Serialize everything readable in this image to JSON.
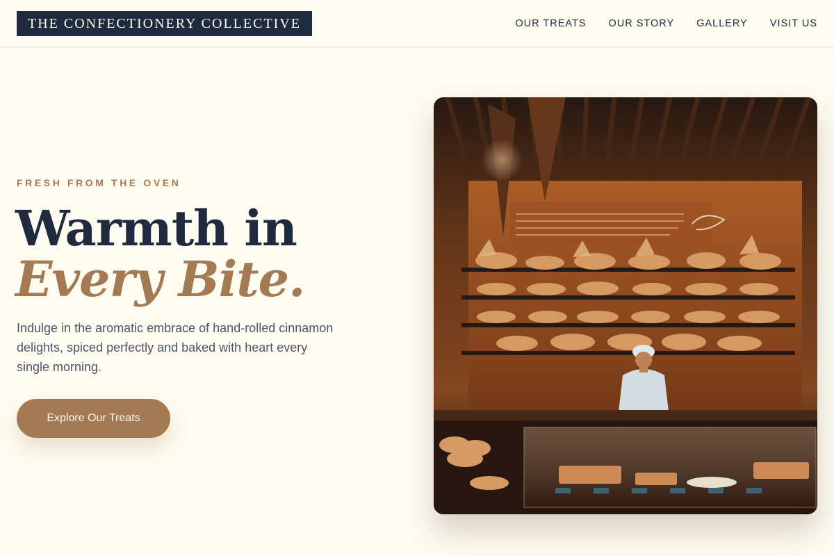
{
  "header": {
    "logo": "THE CONFECTIONERY COLLECTIVE",
    "nav": [
      "OUR TREATS",
      "OUR STORY",
      "GALLERY",
      "VISIT US"
    ]
  },
  "hero": {
    "eyebrow": "FRESH FROM THE OVEN",
    "title_line1": "Warmth in",
    "title_line2": "Every Bite.",
    "description": "Indulge in the aromatic embrace of hand-rolled cinnamon delights, spiced perfectly and baked with heart every single morning.",
    "cta_label": "Explore Our Treats"
  },
  "colors": {
    "background": "#fefbf0",
    "navy": "#1f2a3e",
    "accent": "#a47a55",
    "body_text": "#4b5567"
  },
  "image": {
    "subject": "bakery interior with shelves of bread and a baker behind the counter",
    "icon": "bakery-photo"
  }
}
